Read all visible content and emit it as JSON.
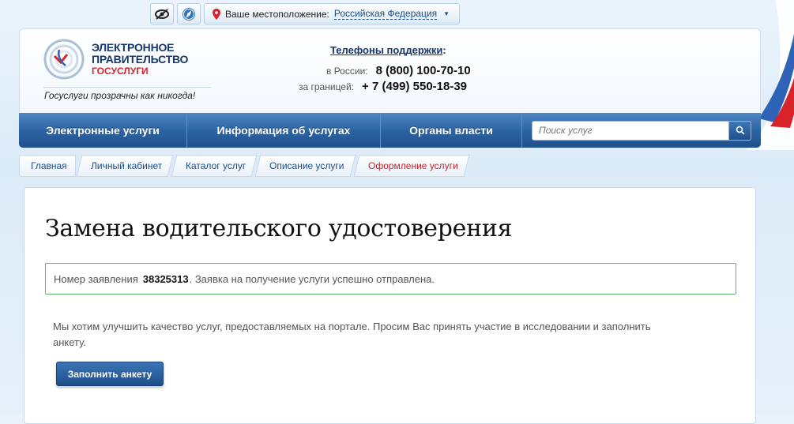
{
  "topbar": {
    "accessibility_icon": "eye-glasses-icon",
    "compass_icon": "compass-icon",
    "location_label": "Ваше местоположение:",
    "location_value": "Российская Федерация"
  },
  "header": {
    "logo_line1": "ЭЛЕКТРОННОЕ",
    "logo_line2": "ПРАВИТЕЛЬСТВО",
    "logo_line3": "ГОСУСЛУГИ",
    "slogan": "Госуслуги прозрачны как никогда!",
    "phones_title": "Телефоны поддержки",
    "phones_colon": ":",
    "phone_ru_label": "в России:",
    "phone_ru": "8 (800) 100-70-10",
    "phone_abroad_label": "за границей:",
    "phone_abroad": "+ 7 (499) 550-18-39"
  },
  "nav": {
    "items": [
      "Электронные услуги",
      "Информация об услугах",
      "Органы власти"
    ],
    "search_placeholder": "Поиск услуг"
  },
  "breadcrumbs": [
    "Главная",
    "Личный кабинет",
    "Каталог услуг",
    "Описание услуги",
    "Оформление услуги"
  ],
  "main": {
    "title": "Замена водительского удостоверения",
    "notice_prefix": "Номер заявления",
    "application_number": "38325313",
    "notice_suffix": ". Заявка на получение услуги успешно отправлена.",
    "survey_text": "Мы хотим улучшить качество услуг, предоставляемых на портале. Просим Вас принять участие в исследовании и заполнить анкету.",
    "survey_button": "Заполнить анкету"
  },
  "colors": {
    "brand_blue": "#1f4f8b",
    "brand_red": "#d8232a",
    "success_border": "#66b36a",
    "active_crumb": "#c0282d"
  }
}
